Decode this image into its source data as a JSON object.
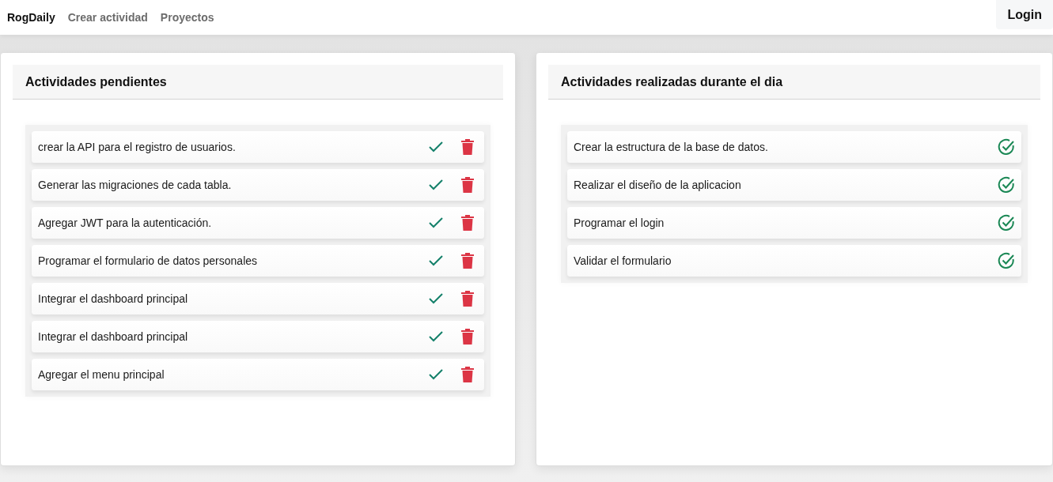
{
  "navbar": {
    "brand": "RogDaily",
    "links": [
      "Crear actividad",
      "Proyectos"
    ],
    "login": "Login"
  },
  "panels": [
    {
      "title": "Actividades pendientes",
      "kind": "pending",
      "items": [
        {
          "text": "crear la API para el registro de usuarios."
        },
        {
          "text": "Generar las migraciones de cada tabla."
        },
        {
          "text": "Agregar JWT para la autenticación."
        },
        {
          "text": "Programar el formulario de datos personales"
        },
        {
          "text": "Integrar el dashboard principal"
        },
        {
          "text": "Integrar el dashboard principal"
        },
        {
          "text": "Agregar el menu principal"
        }
      ]
    },
    {
      "title": "Actividades realizadas durante el dia",
      "kind": "done",
      "items": [
        {
          "text": "Crear la estructura de la base de datos."
        },
        {
          "text": "Realizar el diseño de la aplicacion"
        },
        {
          "text": "Programar el login"
        },
        {
          "text": "Validar el formulario"
        }
      ]
    }
  ]
}
